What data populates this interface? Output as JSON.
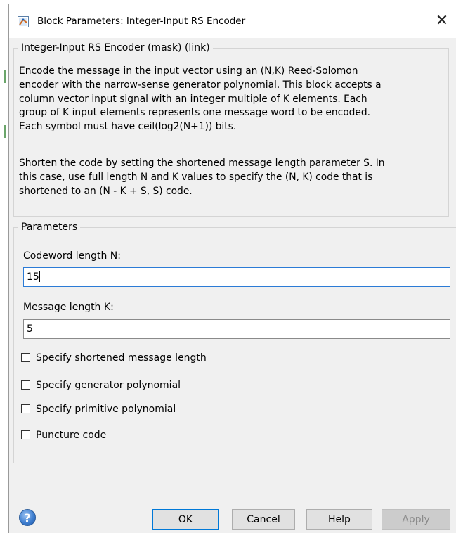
{
  "window": {
    "title": "Block Parameters: Integer-Input RS Encoder",
    "close_glyph": "✕"
  },
  "mask": {
    "legend": "Integer-Input RS Encoder (mask) (link)",
    "description_1": [
      "Encode the message in the input vector using an (N,K) Reed-Solomon",
      "encoder with the narrow-sense generator polynomial.  This block accepts a",
      "column vector input signal with an integer multiple of K elements.  Each",
      "group of K input elements represents one message word to be encoded.",
      "Each symbol must have ceil(log2(N+1)) bits."
    ],
    "description_2": [
      "Shorten the code by setting the shortened message length parameter S. In",
      "this case, use full length N and K values to specify the (N, K) code that is",
      "shortened to an (N - K + S, S) code."
    ]
  },
  "parameters": {
    "legend": "Parameters",
    "codeword_label": "Codeword length N:",
    "codeword_value": "15",
    "message_label": "Message length K:",
    "message_value": "5",
    "checkboxes": [
      {
        "label": "Specify shortened message length",
        "checked": false
      },
      {
        "label": "Specify generator polynomial",
        "checked": false
      },
      {
        "label": "Specify primitive polynomial",
        "checked": false
      },
      {
        "label": "Puncture code",
        "checked": false
      }
    ]
  },
  "buttons": {
    "help_icon": "?",
    "ok": "OK",
    "cancel": "Cancel",
    "help": "Help",
    "apply": "Apply"
  },
  "colors": {
    "accent": "#0078d7",
    "dialog_bg": "#f0f0f0"
  }
}
